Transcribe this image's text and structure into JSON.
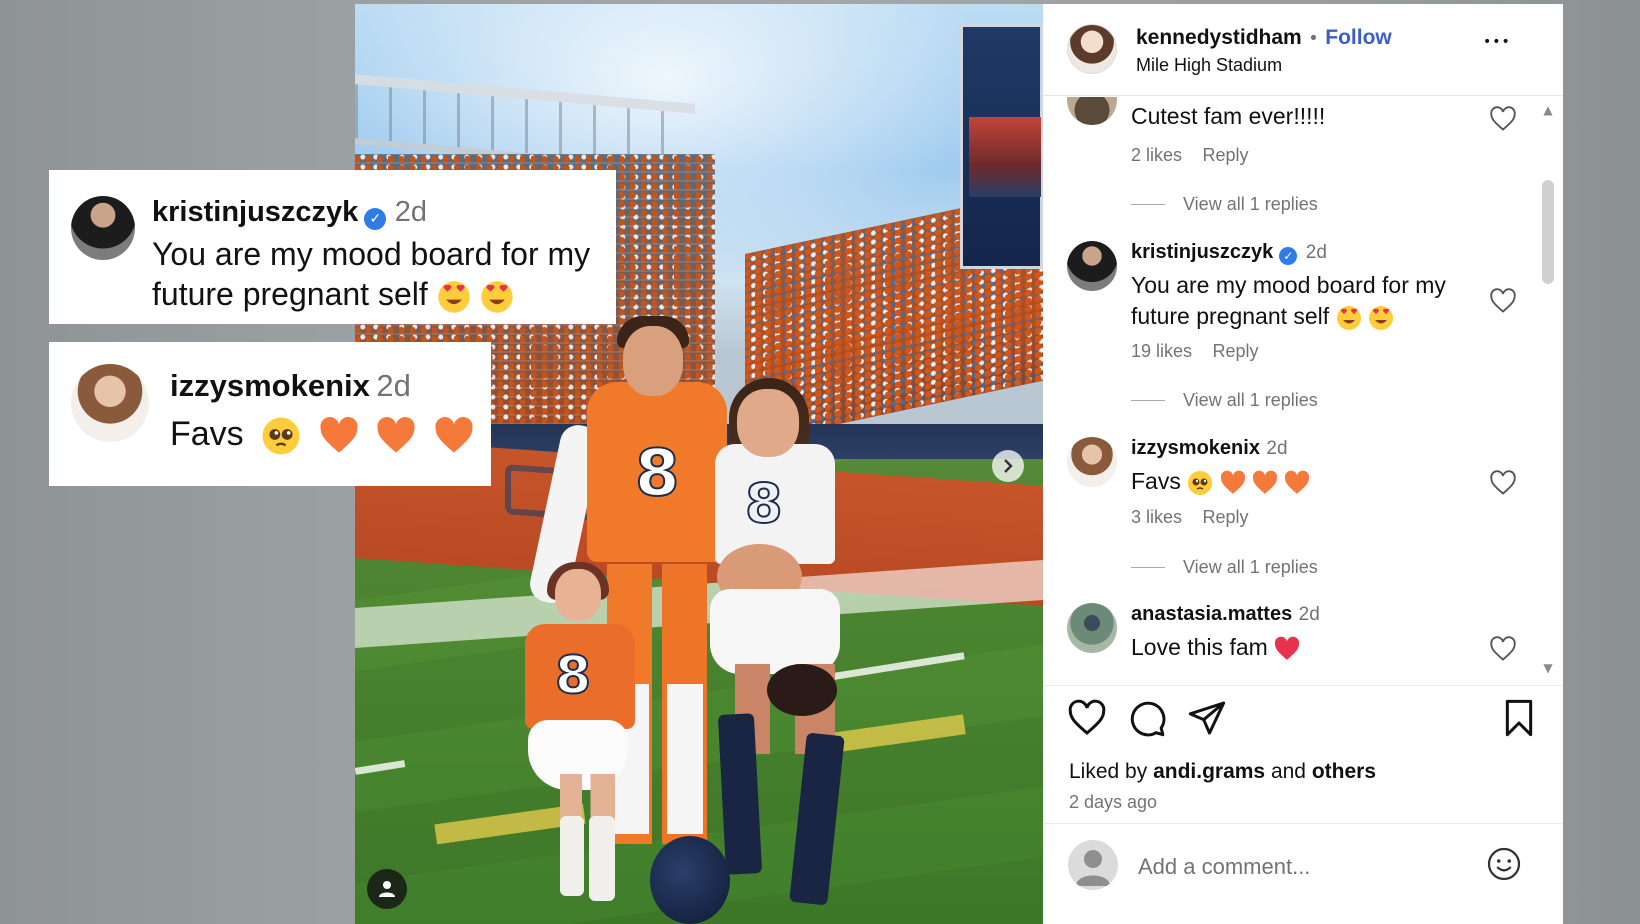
{
  "post": {
    "author": "kennedystidham",
    "separator": "•",
    "follow_label": "Follow",
    "location": "Mile High Stadium",
    "more_label": "•••"
  },
  "comments": [
    {
      "text": "Cutest fam ever!!!!!",
      "likes": "2 likes",
      "reply": "Reply",
      "view_replies": "View all 1 replies"
    },
    {
      "username": "kristinjuszczyk",
      "verified": true,
      "time": "2d",
      "text": "You are my mood board for my future pregnant self",
      "emojis": [
        "heart-eyes",
        "heart-eyes"
      ],
      "likes": "19 likes",
      "reply": "Reply",
      "view_replies": "View all 1 replies"
    },
    {
      "username": "izzysmokenix",
      "time": "2d",
      "text": "Favs",
      "emojis": [
        "pleading-face",
        "orange-heart",
        "orange-heart",
        "orange-heart"
      ],
      "likes": "3 likes",
      "reply": "Reply",
      "view_replies": "View all 1 replies"
    },
    {
      "username": "anastasia.mattes",
      "time": "2d",
      "text": "Love this fam",
      "emojis": [
        "red-heart"
      ]
    }
  ],
  "liked_by": {
    "prefix": "Liked by",
    "user": "andi.grams",
    "joiner": "and",
    "others": "others"
  },
  "timestamp": "2 days ago",
  "add_comment": {
    "placeholder": "Add a comment..."
  },
  "overlay_cards": [
    {
      "username": "kristinjuszczyk",
      "verified": true,
      "time": "2d",
      "line1": "You are my mood board for my",
      "line2": "future pregnant self",
      "emojis": [
        "heart-eyes",
        "heart-eyes"
      ]
    },
    {
      "username": "izzysmokenix",
      "time": "2d",
      "text": "Favs",
      "emojis": [
        "pleading-face",
        "orange-heart",
        "orange-heart",
        "orange-heart"
      ]
    }
  ],
  "photo": {
    "jersey_number": "8",
    "next_icon": "chevron-right-icon",
    "tag_icon": "user-tag-icon"
  },
  "colors": {
    "follow": "#3b5fc8",
    "verified": "#2f7ce6",
    "muted_text": "#737373",
    "broncos_orange": "#f07a2a"
  }
}
